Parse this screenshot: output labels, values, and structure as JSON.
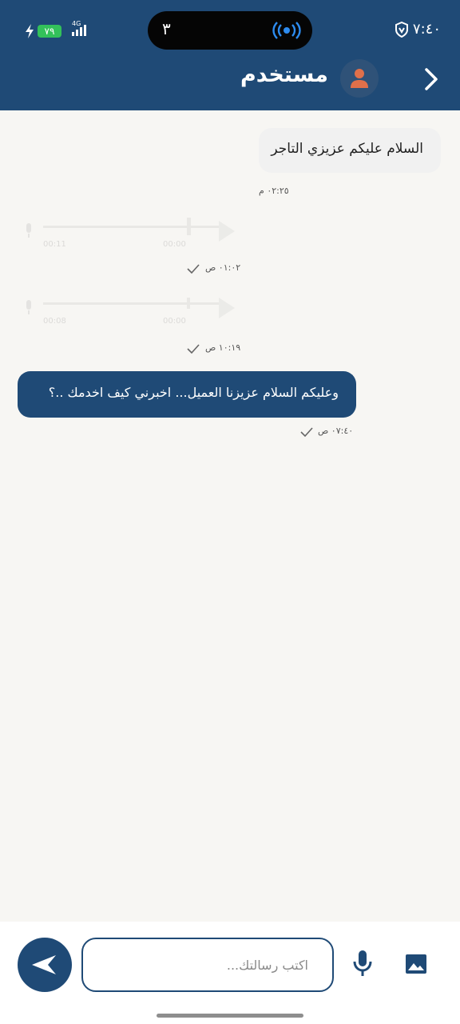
{
  "status_bar": {
    "time": "٧:٤٠",
    "pill_count": "٣",
    "network": "4G",
    "battery": "٧٩"
  },
  "header": {
    "title": "مستخدم"
  },
  "messages": {
    "incoming": {
      "text": "السلام عليكم عزيزي التاجر",
      "time": "٠٢:٢٥ م"
    },
    "audio_1": {
      "time": "٠١:٠٢ ص",
      "duration": "00:00",
      "size": "00:11"
    },
    "audio_2": {
      "time": "١٠:١٩ ص",
      "duration": "00:00",
      "size": "00:08"
    },
    "outgoing": {
      "text": "وعليكم السلام عزيزنا العميل... اخبرني كيف اخدمك ..؟",
      "time": "٠٧:٤٠ ص"
    }
  },
  "composer": {
    "placeholder": "اكتب رسالتك..."
  },
  "colors": {
    "primary": "#1f4a76",
    "background": "#f7f6f3",
    "battery": "#33c15a"
  }
}
